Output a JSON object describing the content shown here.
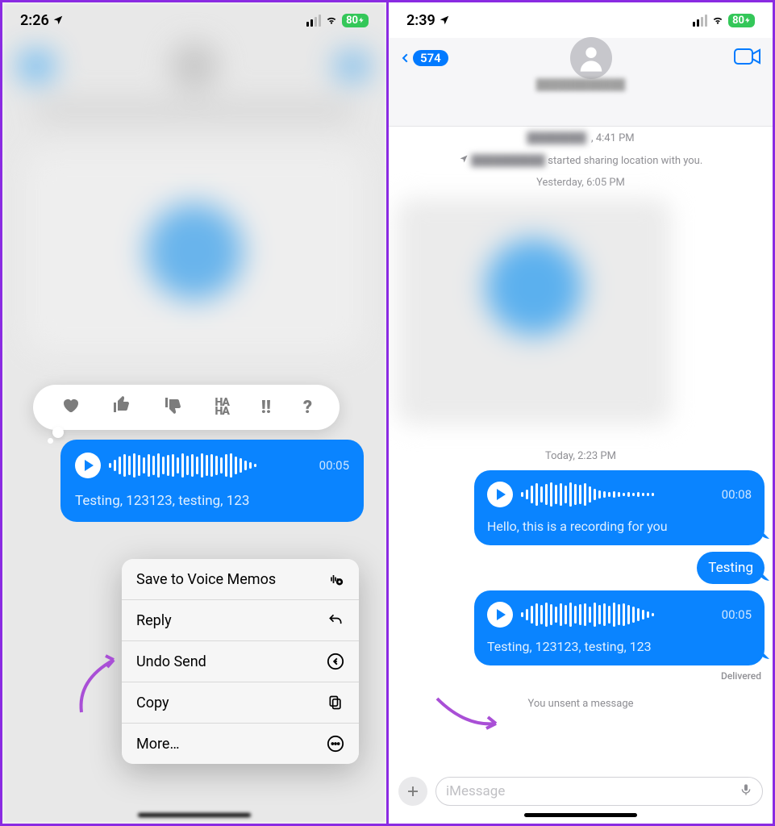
{
  "left": {
    "status": {
      "time": "2:26",
      "battery": "80"
    },
    "tapbacks": [
      "heart",
      "thumbs-up",
      "thumbs-down",
      "haha",
      "exclaim",
      "question"
    ],
    "voice": {
      "duration": "00:05",
      "transcription": "Testing, 123123, testing, 123"
    },
    "menu": {
      "save": "Save to Voice Memos",
      "reply": "Reply",
      "undo": "Undo Send",
      "copy": "Copy",
      "more": "More…"
    }
  },
  "right": {
    "status": {
      "time": "2:39",
      "battery": "80"
    },
    "header": {
      "back_count": "574"
    },
    "timeline": {
      "location_time": ", 4:41 PM",
      "location_text": "started sharing location with you.",
      "ts1": "Yesterday, 6:05 PM",
      "ts2": "Today, 2:23 PM",
      "voice1": {
        "duration": "00:08",
        "transcription": "Hello, this is a recording for you"
      },
      "text1": "Testing",
      "voice2": {
        "duration": "00:05",
        "transcription": "Testing, 123123, testing, 123"
      },
      "delivered": "Delivered",
      "unsent": "You unsent a message"
    },
    "input": {
      "placeholder": "iMessage"
    }
  }
}
